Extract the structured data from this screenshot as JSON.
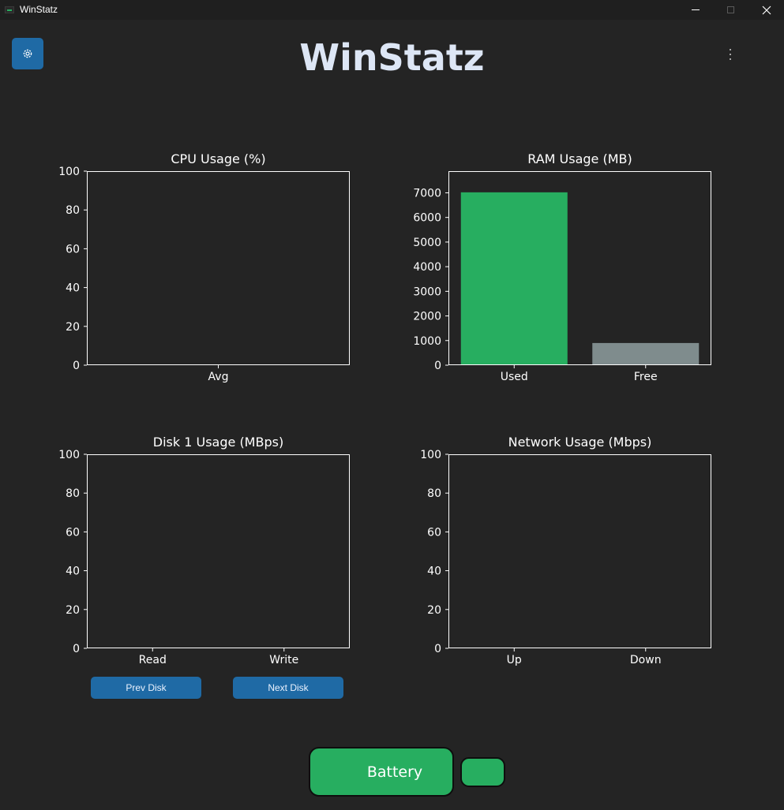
{
  "window": {
    "title": "WinStatz"
  },
  "header": {
    "brand": "WinStatz"
  },
  "colors": {
    "accent": "#1f6aa5",
    "used": "#27ae60",
    "free": "#7f8c8d",
    "background": "#242424"
  },
  "buttons": {
    "prev_disk": "Prev Disk",
    "next_disk": "Next Disk",
    "battery": "Battery"
  },
  "icons": {
    "settings": "gear-icon",
    "menu": "kebab-menu-icon",
    "minimize": "minimize-icon",
    "maximize": "maximize-icon",
    "close": "close-icon"
  },
  "chart_data": [
    {
      "id": "cpu",
      "type": "bar",
      "title": "CPU Usage (%)",
      "categories": [
        "Avg"
      ],
      "series": [
        {
          "values": [
            0
          ]
        }
      ],
      "ylim": [
        0,
        100
      ],
      "yticks": [
        0,
        20,
        40,
        60,
        80,
        100
      ],
      "xlabel": "",
      "ylabel": "",
      "grid": false
    },
    {
      "id": "ram",
      "type": "bar",
      "title": "RAM Usage (MB)",
      "categories": [
        "Used",
        "Free"
      ],
      "series": [
        {
          "values": [
            7020,
            900
          ],
          "colors": [
            "#27ae60",
            "#7f8c8d"
          ]
        }
      ],
      "ylim": [
        0,
        7880
      ],
      "yticks": [
        0,
        1000,
        2000,
        3000,
        4000,
        5000,
        6000,
        7000
      ],
      "xlabel": "",
      "ylabel": "",
      "grid": false
    },
    {
      "id": "disk",
      "type": "bar",
      "title": "Disk 1 Usage (MBps)",
      "categories": [
        "Read",
        "Write"
      ],
      "series": [
        {
          "values": [
            0,
            0
          ]
        }
      ],
      "ylim": [
        0,
        100
      ],
      "yticks": [
        0,
        20,
        40,
        60,
        80,
        100
      ],
      "xlabel": "",
      "ylabel": "",
      "grid": false
    },
    {
      "id": "net",
      "type": "bar",
      "title": "Network Usage (Mbps)",
      "categories": [
        "Up",
        "Down"
      ],
      "series": [
        {
          "values": [
            0,
            0
          ]
        }
      ],
      "ylim": [
        0,
        100
      ],
      "yticks": [
        0,
        20,
        40,
        60,
        80,
        100
      ],
      "xlabel": "",
      "ylabel": "",
      "grid": false
    }
  ]
}
